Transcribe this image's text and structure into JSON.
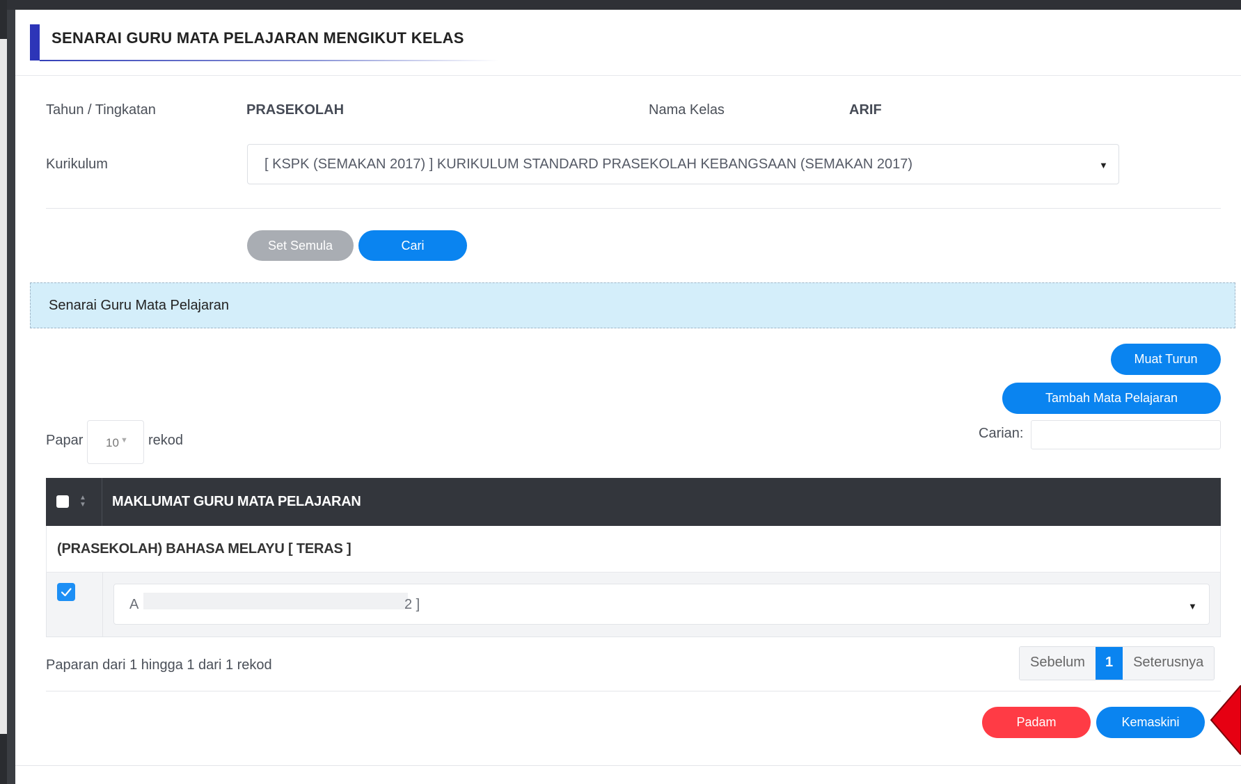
{
  "modal": {
    "title": "SENARAI GURU MATA PELAJARAN MENGIKUT KELAS"
  },
  "form": {
    "tahun_label": "Tahun / Tingkatan",
    "tahun_value": "PRASEKOLAH",
    "kelas_label": "Nama Kelas",
    "kelas_value": "ARIF",
    "kurikulum_label": "Kurikulum",
    "kurikulum_value": "[ KSPK (SEMAKAN 2017) ] KURIKULUM STANDARD PRASEKOLAH KEBANGSAAN (SEMAKAN 2017)",
    "reset_label": "Set Semula",
    "search_label": "Cari"
  },
  "section": {
    "title": "Senarai Guru Mata Pelajaran"
  },
  "actions": {
    "download_label": "Muat Turun",
    "add_subject_label": "Tambah Mata Pelajaran"
  },
  "datatable": {
    "show_prefix": "Papar",
    "page_length": "10",
    "show_suffix": "rekod",
    "search_label": "Carian:",
    "search_value": "",
    "header": "MAKLUMAT GURU MATA PELAJARAN",
    "group_title": "(PRASEKOLAH) BAHASA MELAYU [ TERAS ]",
    "teacher_value_start": "A",
    "teacher_value_end": "2 ]",
    "row_checked": true,
    "info": "Paparan dari 1 hingga 1 dari 1 rekod",
    "prev_label": "Sebelum",
    "current_page": "1",
    "next_label": "Seterusnya"
  },
  "footer": {
    "delete_label": "Padam",
    "update_label": "Kemaskini"
  },
  "colors": {
    "primary": "#0a84f0",
    "danger": "#ff3b45",
    "secondary": "#a9adb3",
    "header_dark": "#33363c",
    "info_bg": "#d4eefa",
    "title_accent": "#2d35b8"
  }
}
